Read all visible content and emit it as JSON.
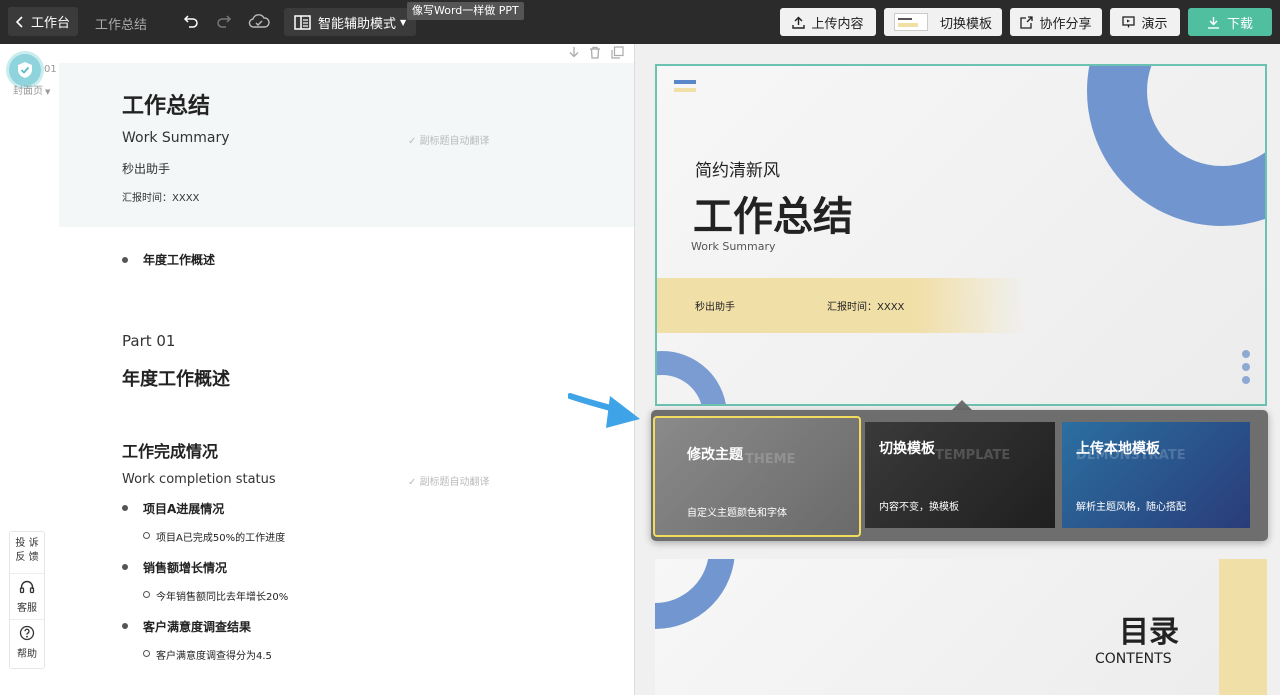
{
  "topbar": {
    "back_label": "工作台",
    "doc_title": "工作总结",
    "mode_label": "智能辅助模式",
    "tooltip": "像写Word一样做 PPT",
    "upload_label": "上传内容",
    "switch_template_label": "切换模板",
    "share_label": "协作分享",
    "present_label": "演示",
    "download_label": "下载"
  },
  "rail": {
    "page_num": "01",
    "page_type": "封面页"
  },
  "editor": {
    "cover_title": "工作总结",
    "cover_subtitle": "Work Summary",
    "cover_author": "秒出助手",
    "cover_date": "汇报时间：XXXX",
    "auto_translate": "副标题自动翻译",
    "toc_item": "年度工作概述",
    "part_label": "Part 01",
    "part_title": "年度工作概述",
    "section_title": "工作完成情况",
    "section_subtitle": "Work completion status",
    "items": [
      {
        "title": "项目A进展情况",
        "sub": "项目A已完成50%的工作进度"
      },
      {
        "title": "销售额增长情况",
        "sub": "今年销售额同比去年增长20%"
      },
      {
        "title": "客户满意度调查结果",
        "sub": "客户满意度调查得分为4.5"
      }
    ]
  },
  "help": {
    "feedback_line1": "投 诉",
    "feedback_line2": "反 馈",
    "service": "客服",
    "help": "帮助"
  },
  "slide1": {
    "style_label": "简约清新风",
    "title": "工作总结",
    "subtitle": "Work Summary",
    "author": "秒出助手",
    "date": "汇报时间：XXXX"
  },
  "popup": {
    "cards": [
      {
        "title": "修改主题",
        "bg": "THEME",
        "desc": "自定义主题颜色和字体"
      },
      {
        "title": "切换模板",
        "bg": "TEMPLATE",
        "desc": "内容不变，换模板"
      },
      {
        "title": "上传本地模板",
        "bg": "DEMONSTRATE",
        "desc": "解析主题风格，随心搭配"
      }
    ]
  },
  "slide2": {
    "title": "目录",
    "subtitle": "CONTENTS"
  },
  "colors": {
    "accent_green": "#4fbf9f",
    "highlight_yellow": "#f2dc5d",
    "arc_blue": "#5b86c9",
    "band_yellow": "#f1dfa8"
  }
}
